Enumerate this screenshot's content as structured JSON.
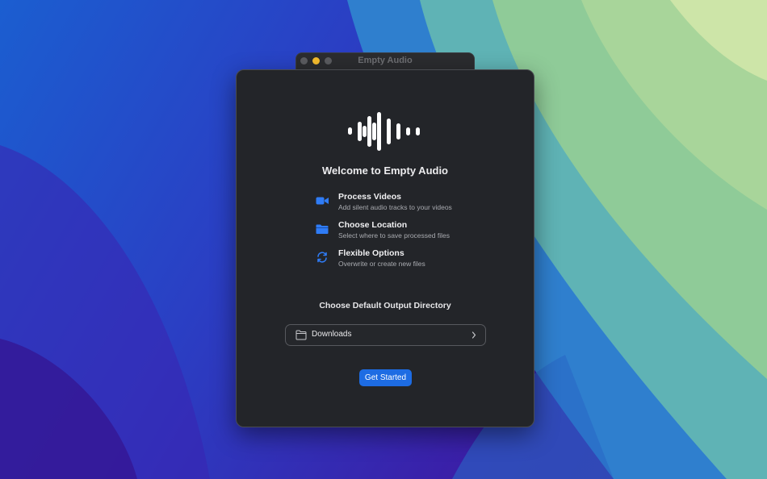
{
  "background_window": {
    "title": "Empty Audio"
  },
  "dialog": {
    "welcome_title": "Welcome to Empty Audio",
    "logo_icon": "waveform-icon",
    "features": [
      {
        "icon": "video-camera-icon",
        "title": "Process Videos",
        "description": "Add silent audio tracks to your videos"
      },
      {
        "icon": "folder-icon",
        "title": "Choose Location",
        "description": "Select where to save processed files"
      },
      {
        "icon": "sync-arrows-icon",
        "title": "Flexible Options",
        "description": "Overwrite or create new files"
      }
    ],
    "output_section_title": "Choose Default Output Directory",
    "output_directory": {
      "icon": "folder-outline-icon",
      "value": "Downloads"
    },
    "primary_button": "Get Started"
  },
  "colors": {
    "accent": "#1d6ce3",
    "icon_blue": "#2f7cf6",
    "dialog_bg": "#232529",
    "traffic_yellow": "#f5bd2e"
  }
}
